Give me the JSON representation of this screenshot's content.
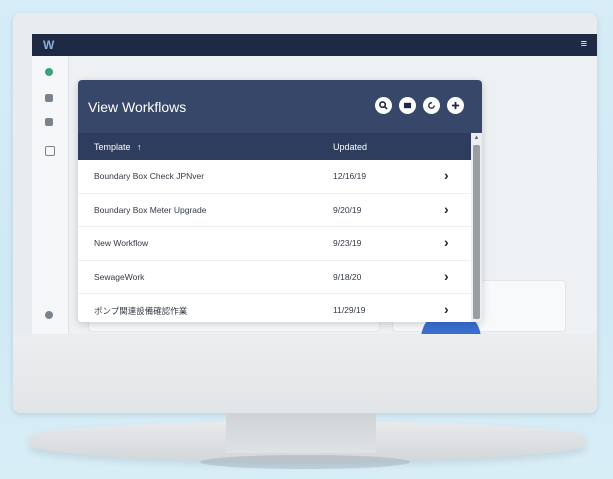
{
  "app": {
    "logo": "W",
    "menu_glyph": "≡"
  },
  "workflows": {
    "title": "View Workflows",
    "columns": {
      "template": "Template",
      "sort_indicator": "↑",
      "updated": "Updated"
    },
    "rows": [
      {
        "name": "Boundary Box Check JPNver",
        "updated": "12/16/19"
      },
      {
        "name": "Boundary Box Meter Upgrade",
        "updated": "9/20/19"
      },
      {
        "name": "New Workflow",
        "updated": "9/23/19"
      },
      {
        "name": "SewageWork",
        "updated": "9/18/20"
      },
      {
        "name": "ポンプ関連設備確認作業",
        "updated": "11/29/19"
      }
    ],
    "toolbar_icons": [
      "search-icon",
      "folder-icon",
      "refresh-icon",
      "add-icon"
    ]
  },
  "colors": {
    "topbar": "#1e2a44",
    "card_header": "#37476a",
    "column_header": "#2e3d5e",
    "accent_blue": "#3a6fd0"
  }
}
